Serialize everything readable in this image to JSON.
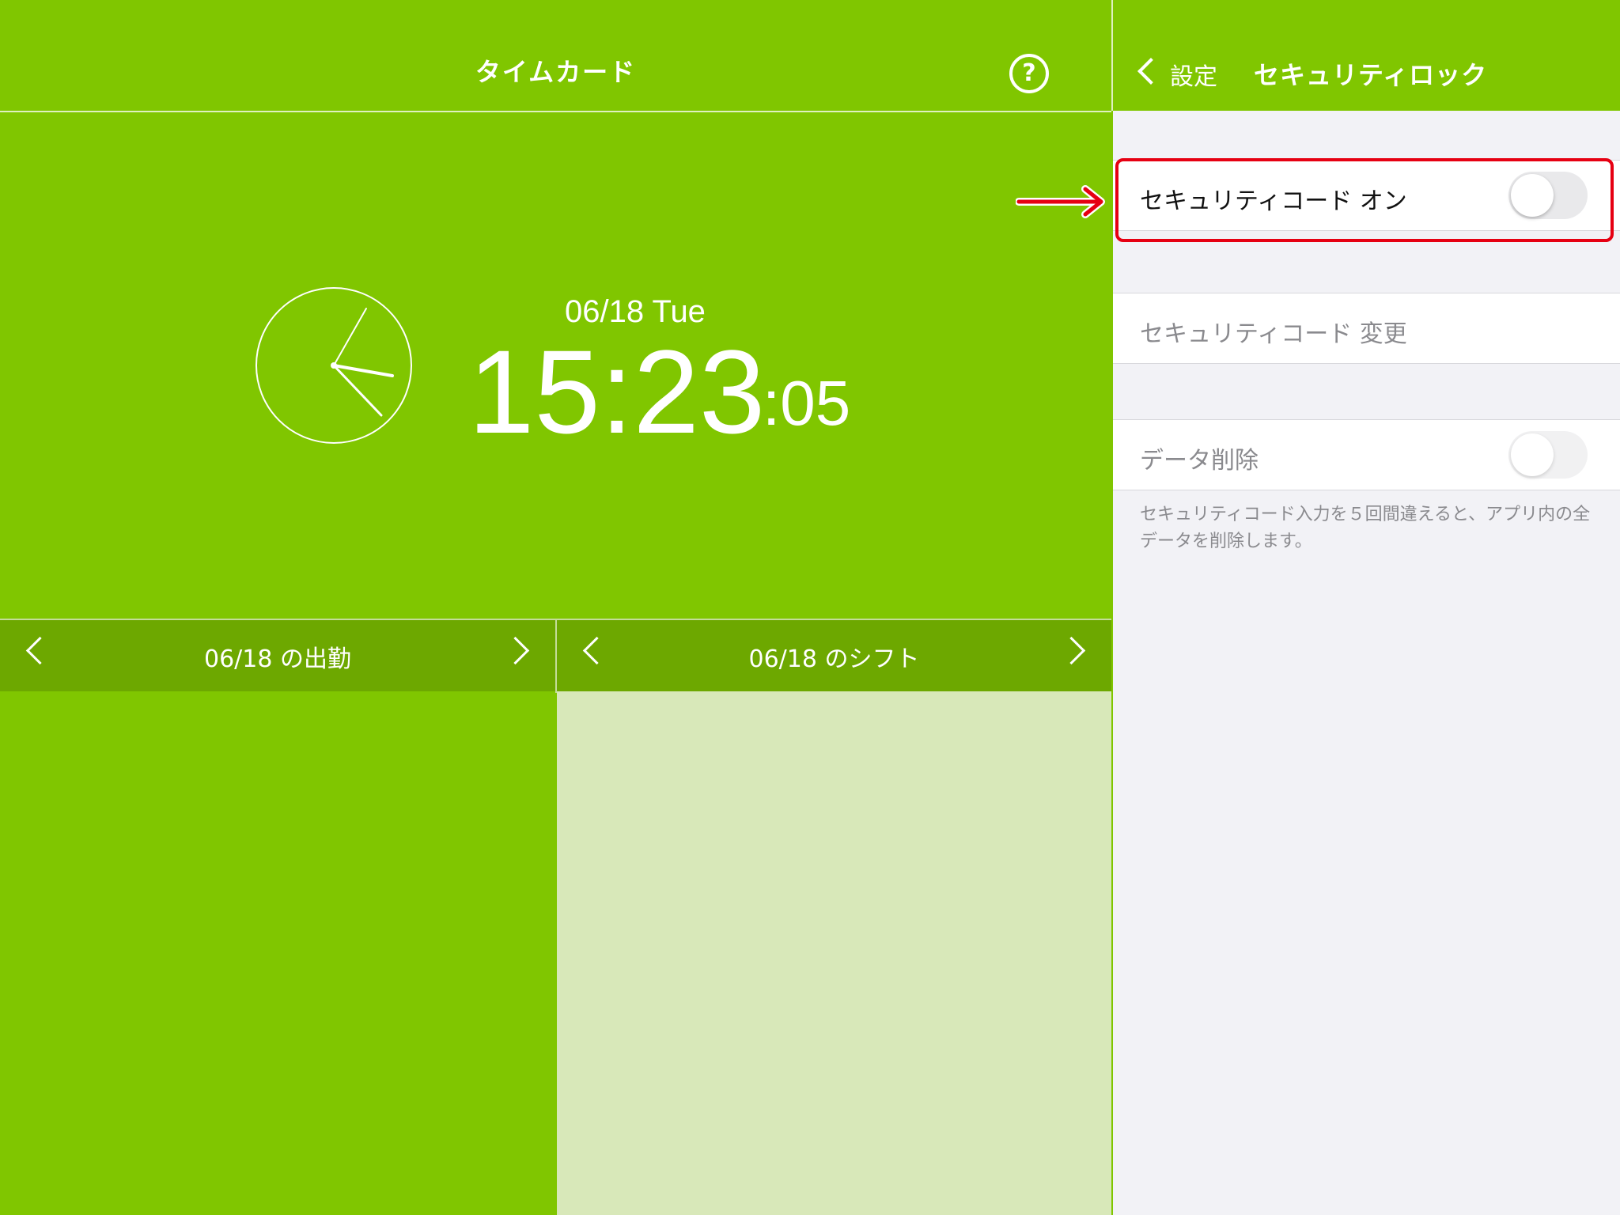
{
  "left": {
    "title": "タイムカード",
    "help_icon": "question-circle-icon",
    "help_label": "?",
    "date": "06/18 Tue",
    "time": "15:23",
    "seconds": ":05",
    "attendance_bar": {
      "label": "06/18 の出勤"
    },
    "shift_bar": {
      "label": "06/18 のシフト"
    }
  },
  "right": {
    "back_label": "設定",
    "title": "セキュリティロック",
    "rows": [
      {
        "label": "セキュリティコード オン",
        "toggle_on": false
      },
      {
        "label": "セキュリティコード 変更"
      },
      {
        "label": "データ削除",
        "toggle_on": false
      }
    ],
    "footnote": "セキュリティコード入力を５回間違えると、アプリ内の全データを削除します。"
  },
  "colors": {
    "brand_green": "#80c600",
    "bar_green": "#6da800",
    "shift_bg": "#d8e8b9",
    "settings_bg": "#f2f2f6",
    "highlight_red": "#e60012"
  }
}
